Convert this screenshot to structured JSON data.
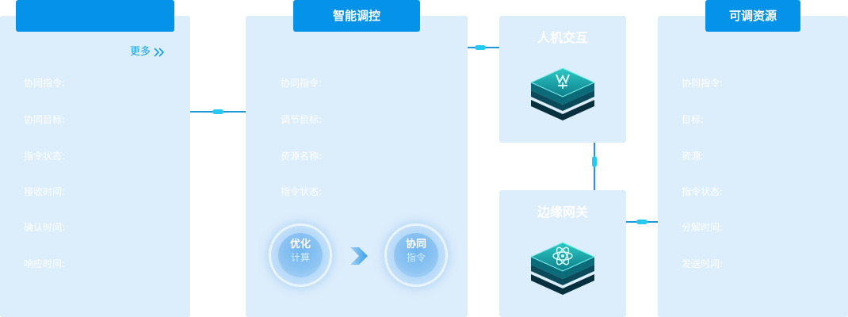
{
  "panel1": {
    "tab_title": "",
    "more_label": "更多",
    "rows": [
      {
        "label": "协同指令:"
      },
      {
        "label": "协同目标:"
      },
      {
        "label": "指令状态:"
      },
      {
        "label": "接收时间:"
      },
      {
        "label": "确认时间:"
      },
      {
        "label": "响应时间:"
      }
    ]
  },
  "panel2": {
    "tab_title": "智能调控",
    "rows": [
      {
        "label": "协同指令:"
      },
      {
        "label": "调节目标:"
      },
      {
        "label": "资源名称:"
      },
      {
        "label": "指令状态:"
      }
    ],
    "flow": {
      "step1_line1": "优化",
      "step1_line2": "计算",
      "step2_line1": "协同",
      "step2_line2": "指令"
    }
  },
  "node_hmi": {
    "title": "人机交互",
    "icon": "stacked-cube-hand-icon"
  },
  "node_gateway": {
    "title": "边缘网关",
    "icon": "stacked-cube-atom-icon"
  },
  "panel4": {
    "tab_title": "可调资源",
    "rows": [
      {
        "label": "协同指令:"
      },
      {
        "label": "目标:"
      },
      {
        "label": "资源:"
      },
      {
        "label": "指令状态:"
      },
      {
        "label": "分解时间:"
      },
      {
        "label": "发送时间:"
      }
    ]
  },
  "colors": {
    "panel_bg": "#dcedfb",
    "tab_bg": "#0593ea",
    "connector": "#1f97df",
    "connector_dot": "#27c8f2",
    "link": "#13a4e0",
    "cube_teal": "#0f8f9a"
  }
}
